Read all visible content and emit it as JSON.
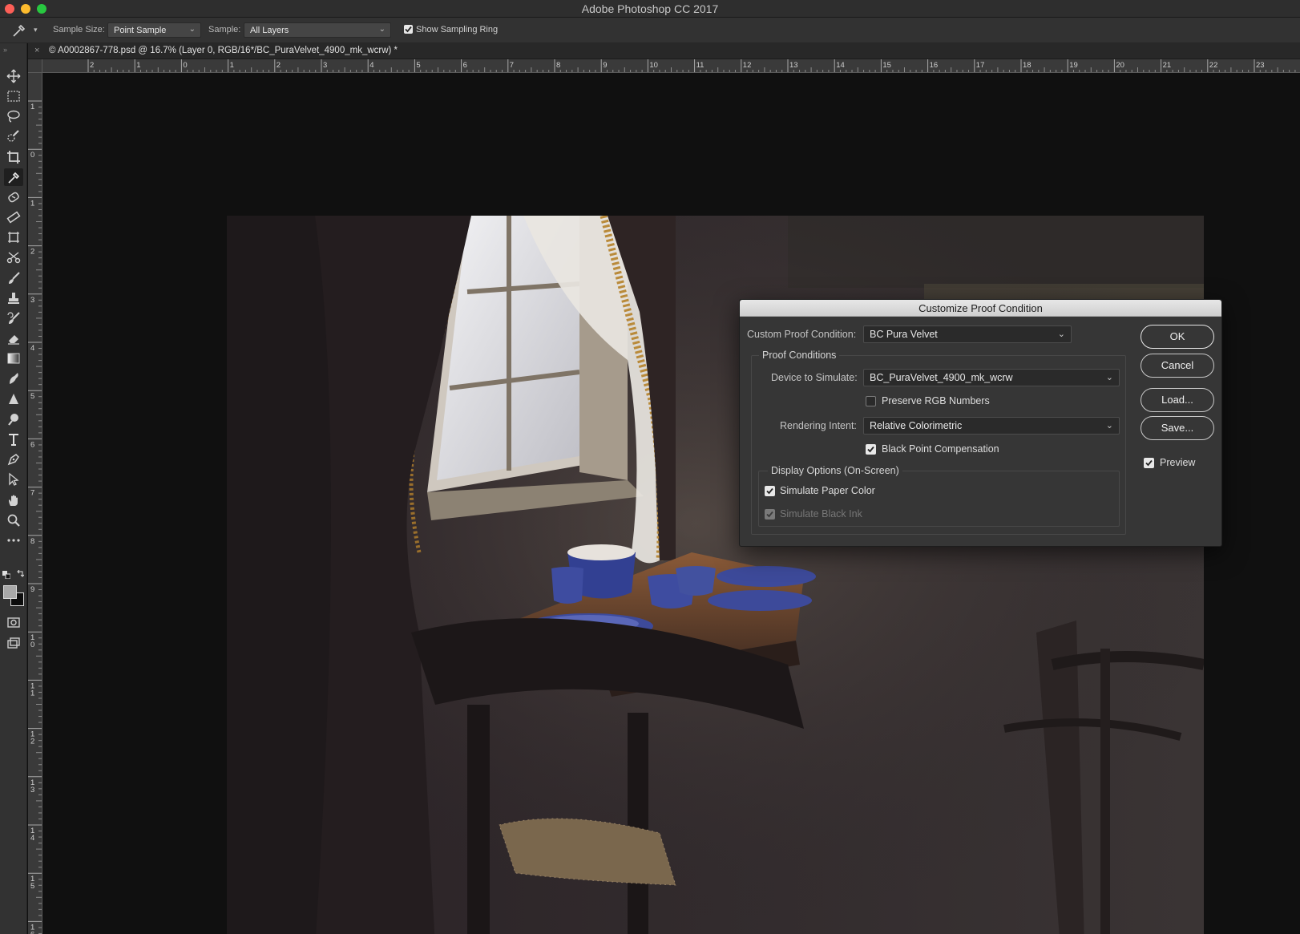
{
  "window": {
    "title": "Adobe Photoshop CC 2017"
  },
  "options_bar": {
    "sample_size_label": "Sample Size:",
    "sample_size_value": "Point Sample",
    "sample_label": "Sample:",
    "sample_value": "All Layers",
    "show_sampling_ring_label": "Show Sampling Ring",
    "show_sampling_ring_checked": true
  },
  "document": {
    "tab_title": "© A0002867-778.psd @ 16.7% (Layer 0, RGB/16*/BC_PuraVelvet_4900_mk_wcrw) *",
    "close_glyph": "×"
  },
  "rulers": {
    "horizontal_labels": [
      "2",
      "1",
      "0",
      "1",
      "2",
      "3",
      "4",
      "5",
      "6",
      "7",
      "8",
      "9",
      "10",
      "11",
      "12",
      "13",
      "14",
      "15",
      "16",
      "17",
      "18",
      "19",
      "20",
      "21",
      "22",
      "23"
    ],
    "vertical_labels": [
      "1",
      "0",
      "1",
      "2",
      "3",
      "4",
      "5",
      "6",
      "7",
      "8",
      "9",
      "10",
      "11",
      "12",
      "13",
      "14",
      "15",
      "16"
    ]
  },
  "tools": [
    {
      "name": "move-tool-icon",
      "active": false
    },
    {
      "name": "marquee-tool-icon",
      "active": false
    },
    {
      "name": "lasso-tool-icon",
      "active": false
    },
    {
      "name": "quick-select-tool-icon",
      "active": false
    },
    {
      "name": "crop-tool-icon",
      "active": false
    },
    {
      "name": "eyedropper-tool-icon",
      "active": true
    },
    {
      "name": "healing-brush-tool-icon",
      "active": false
    },
    {
      "name": "ruler-tool-icon",
      "active": false
    },
    {
      "name": "frame-tool-icon",
      "active": false
    },
    {
      "name": "scissors-tool-icon",
      "active": false
    },
    {
      "name": "brush-tool-icon",
      "active": false
    },
    {
      "name": "stamp-tool-icon",
      "active": false
    },
    {
      "name": "history-brush-tool-icon",
      "active": false
    },
    {
      "name": "eraser-tool-icon",
      "active": false
    },
    {
      "name": "gradient-tool-icon",
      "active": false
    },
    {
      "name": "smudge-tool-icon",
      "active": false
    },
    {
      "name": "sharpen-tool-icon",
      "active": false
    },
    {
      "name": "dodge-tool-icon",
      "active": false
    },
    {
      "name": "type-tool-icon",
      "active": false
    },
    {
      "name": "pen-tool-icon",
      "active": false
    },
    {
      "name": "path-select-tool-icon",
      "active": false
    },
    {
      "name": "hand-tool-icon",
      "active": false
    },
    {
      "name": "zoom-tool-icon",
      "active": false
    },
    {
      "name": "more-tools-icon",
      "active": false
    }
  ],
  "colors": {
    "foreground": "#a9a9a9",
    "background": "#0d0d0d"
  },
  "dialog": {
    "title": "Customize Proof Condition",
    "custom_proof_condition_label": "Custom Proof Condition:",
    "custom_proof_condition_value": "BC Pura Velvet",
    "proof_conditions_title": "Proof Conditions",
    "device_to_simulate_label": "Device to Simulate:",
    "device_to_simulate_value": "BC_PuraVelvet_4900_mk_wcrw",
    "preserve_rgb_label": "Preserve RGB Numbers",
    "preserve_rgb_checked": false,
    "rendering_intent_label": "Rendering Intent:",
    "rendering_intent_value": "Relative Colorimetric",
    "black_point_label": "Black Point Compensation",
    "black_point_checked": true,
    "display_options_title": "Display Options (On-Screen)",
    "simulate_paper_label": "Simulate Paper Color",
    "simulate_paper_checked": true,
    "simulate_ink_label": "Simulate Black Ink",
    "simulate_ink_checked": true,
    "simulate_ink_enabled": false,
    "ok_label": "OK",
    "cancel_label": "Cancel",
    "load_label": "Load...",
    "save_label": "Save...",
    "preview_label": "Preview",
    "preview_checked": true
  }
}
